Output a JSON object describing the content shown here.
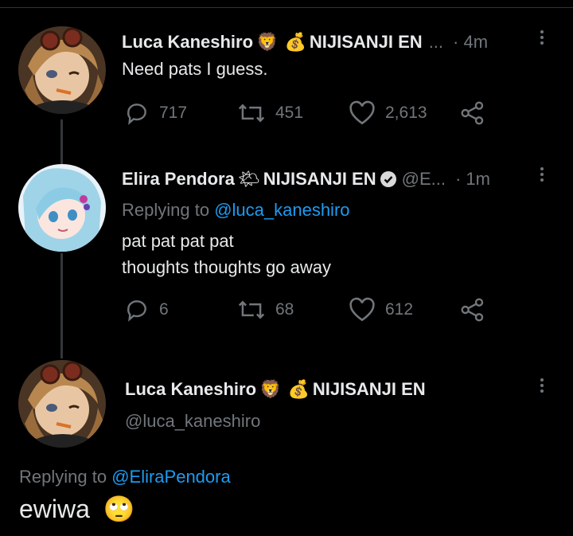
{
  "tweets": [
    {
      "name": "Luca Kaneshiro",
      "emoji1": "🦁",
      "emoji2": "💰",
      "group": "NIJISANJI EN",
      "ellipsis": "...",
      "time": "· 4m",
      "text": "Need pats I guess.",
      "replies": "717",
      "retweets": "451",
      "likes": "2,613"
    },
    {
      "name": "Elira Pendora",
      "emoji1": "🌤",
      "group": "NIJISANJI EN",
      "handle": "@E...",
      "time": "· 1m",
      "reply_prefix": "Replying to ",
      "reply_handle": "@luca_kaneshiro",
      "text_line1": "pat pat pat pat",
      "text_line2": "thoughts thoughts go away",
      "replies": "6",
      "retweets": "68",
      "likes": "612"
    }
  ],
  "main_tweet": {
    "name": "Luca Kaneshiro",
    "emoji1": "🦁",
    "emoji2": "💰",
    "group": "NIJISANJI EN",
    "handle": "@luca_kaneshiro",
    "reply_prefix": "Replying to ",
    "reply_handle": "@EliraPendora",
    "text": "ewiwa",
    "text_emoji": "🙄"
  },
  "colors": {
    "background": "#000000",
    "text": "#e7e9ea",
    "muted": "#71767b",
    "link": "#1d9bf0",
    "thread_line": "#333639"
  }
}
